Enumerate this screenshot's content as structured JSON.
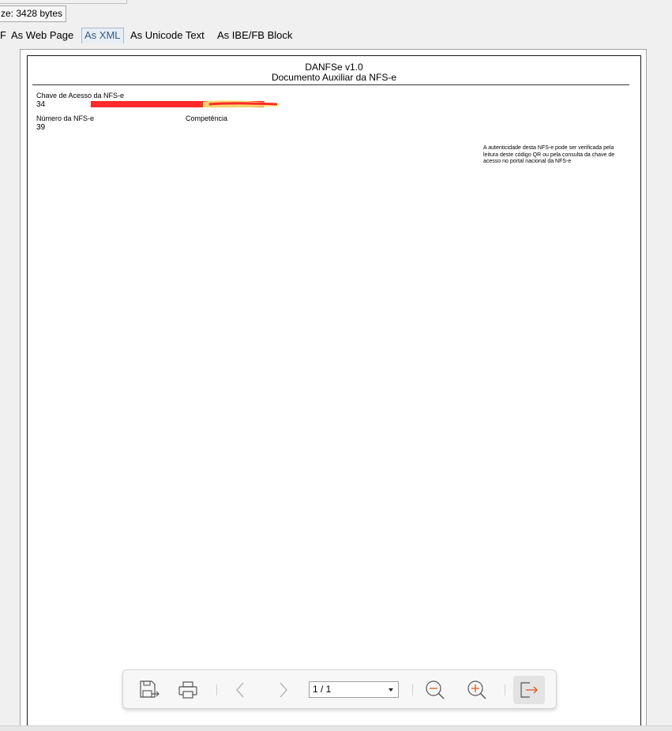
{
  "status": {
    "size_label": "ze: 3428 bytes"
  },
  "tabs": {
    "cut_label": "F",
    "items": [
      {
        "label": "As Web Page"
      },
      {
        "label": "As XML"
      },
      {
        "label": "As Unicode Text"
      },
      {
        "label": "As IBE/FB Block"
      }
    ],
    "selected_index": 1
  },
  "document": {
    "title_line1": "DANFSe v1.0",
    "title_line2": "Documento Auxiliar da NFS-e",
    "access_key_label": "Chave de Acesso da NFS-e",
    "access_key_value": "34",
    "nfse_number_label": "Número da NFS-e",
    "nfse_number_value": "39",
    "competence_label": "Competência",
    "qr_note": "A autenticidade desta NFS-e pode ser verificada pela leitura deste código QR ou pela consulta da chave de acesso no portal nacional da NFS-e"
  },
  "toolbar": {
    "page_indicator": "1 / 1",
    "icons": [
      "save-icon",
      "print-icon",
      "previous-page-icon",
      "next-page-icon",
      "zoom-out-icon",
      "zoom-in-icon",
      "exit-icon"
    ]
  },
  "colors": {
    "redaction_red": "#ff2a2a",
    "highlight_yellow": "#f4f17a",
    "exit_arrow": "#e0561e",
    "selected_tab_text": "#3a5a7e"
  }
}
